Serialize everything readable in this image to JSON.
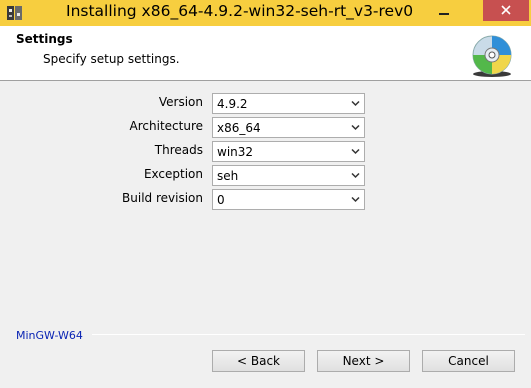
{
  "window": {
    "title": "Installing x86_64-4.9.2-win32-seh-rt_v3-rev0"
  },
  "icons": {
    "app": "mingw-installer-icon",
    "header": "cd-disc-icon",
    "minimize": "minimize-icon",
    "close": "close-icon",
    "dropdown": "chevron-down-icon"
  },
  "colors": {
    "titlebar": "#f7ce3f",
    "close_button": "#c75050",
    "brand_text": "#0a24b4"
  },
  "header": {
    "title": "Settings",
    "subtitle": "Specify setup settings."
  },
  "settings": {
    "version": {
      "label": "Version",
      "value": "4.9.2"
    },
    "architecture": {
      "label": "Architecture",
      "value": "x86_64"
    },
    "threads": {
      "label": "Threads",
      "value": "win32"
    },
    "exception": {
      "label": "Exception",
      "value": "seh"
    },
    "build_revision": {
      "label": "Build revision",
      "value": "0"
    }
  },
  "footer": {
    "brand": "MinGW-W64",
    "back_label": "< Back",
    "next_label": "Next >",
    "cancel_label": "Cancel"
  }
}
